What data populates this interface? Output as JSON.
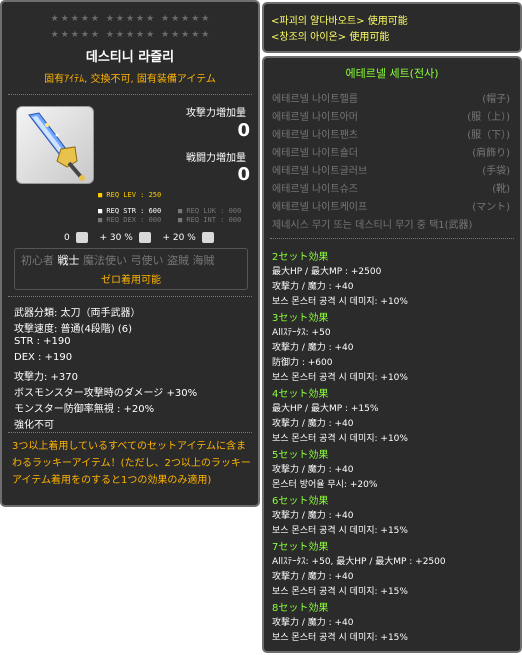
{
  "item": {
    "stars_row1": "★★★★★ ★★★★★ ★★★★★",
    "stars_row2": "★★★★★ ★★★★★ ★★★★★",
    "name": "데스티니 라즐리",
    "attributes": "固有ｱｲﾃﾑ, 交換不可, 固有装備アイテム",
    "attack_increase_label": "攻撃力増加量",
    "attack_increase_value": "0",
    "combat_increase_label": "戦闘力増加量",
    "combat_increase_value": "0",
    "req_lev": "■ REQ LEV : 250",
    "req_str": "■ REQ STR : 600",
    "req_dex": "■ REQ DEX : 000",
    "req_luk": "■ REQ LUK : 000",
    "req_int": "■ REQ INT : 000",
    "damage_row": {
      "v1": "0",
      "v2": "+ 30 %",
      "v3": "+ 20 %"
    },
    "jobs": [
      "初心者",
      "戦士",
      "魔法使い",
      "弓使い",
      "盗賊",
      "海賊"
    ],
    "zero_usable": "ゼロ着用可能",
    "stats": [
      "武器分類: 太刀（両手武器）",
      "攻撃速度: 普通(4段階) (6)",
      "STR : +190",
      "DEX : +190",
      "攻撃力: +370",
      "ボスモンスター攻撃時のダメージ +30%",
      "モンスター防御率無視 : +20%",
      "強化不可"
    ],
    "lucky_text": "3つ以上着用しているすべてのセットアイテムに含まわるラッキーアイテム！(ただし、2つ以上のラッキーアイテム着用をのすると1つの効果のみ適用)"
  },
  "potentials": {
    "line1": "<파괴의 얄다바오트> 使用可能",
    "line2": "<창조의 아이온> 使用可能"
  },
  "set": {
    "title": "에테르넬 세트(전사)",
    "items": [
      {
        "name": "에테르넬 나이트헬름",
        "slot": "(帽子)"
      },
      {
        "name": "에테르넬 나이트아머",
        "slot": "(服（上）)"
      },
      {
        "name": "에테르넬 나이트팬츠",
        "slot": "(服（下）)"
      },
      {
        "name": "에테르넬 나이트숄더",
        "slot": "(肩飾り)"
      },
      {
        "name": "에테르넬 나이트글러브",
        "slot": "(手袋)"
      },
      {
        "name": "에테르넬 나이트슈즈",
        "slot": "(靴)"
      },
      {
        "name": "에테르넬 나이트케이프",
        "slot": "(マント)"
      },
      {
        "name": "제네시스 무기 또는 데스티니 무기 중 택1(武器)",
        "slot": ""
      }
    ],
    "effects": [
      {
        "head": "2セット効果",
        "lines": [
          "最大HP / 最大MP : +2500",
          "攻撃力 / 魔力 : +40",
          "보스 몬스터 공격 시 데미지: +10%"
        ]
      },
      {
        "head": "3セット効果",
        "lines": [
          "Allｽﾃｰﾀｽ: +50",
          "攻撃力 / 魔力 : +40",
          "防御力 : +600",
          "보스 몬스터 공격 시 데미지: +10%"
        ]
      },
      {
        "head": "4セット効果",
        "lines": [
          "最大HP / 最大MP : +15%",
          "攻撃力 / 魔力 : +40",
          "보스 몬스터 공격 시 데미지: +10%"
        ]
      },
      {
        "head": "5セット効果",
        "lines": [
          "攻撃力 / 魔力 : +40",
          "몬스터 방어율 무시: +20%"
        ]
      },
      {
        "head": "6セット効果",
        "lines": [
          "攻撃力 / 魔力 : +40",
          "보스 몬스터 공격 시 데미지: +15%"
        ]
      },
      {
        "head": "7セット効果",
        "lines": [
          "Allｽﾃｰﾀｽ: +50, 最大HP / 最大MP : +2500",
          "攻撃力 / 魔力 : +40",
          "보스 몬스터 공격 시 데미지: +15%"
        ]
      },
      {
        "head": "8セット効果",
        "lines": [
          "攻撃力 / 魔力 : +40",
          "보스 몬스터 공격 시 데미지: +15%"
        ]
      }
    ]
  },
  "colors": {
    "panel_bg": "#2b2b2b",
    "gold": "#ffb400",
    "set_green": "#8cff3a",
    "potential_yellow": "#ffff66",
    "disabled_gray": "#777777"
  },
  "icons": {
    "weapon": "sword-weapon-icon",
    "damage1": "damage-icon",
    "damage2": "boss-damage-icon",
    "damage3": "ignore-defense-icon"
  }
}
